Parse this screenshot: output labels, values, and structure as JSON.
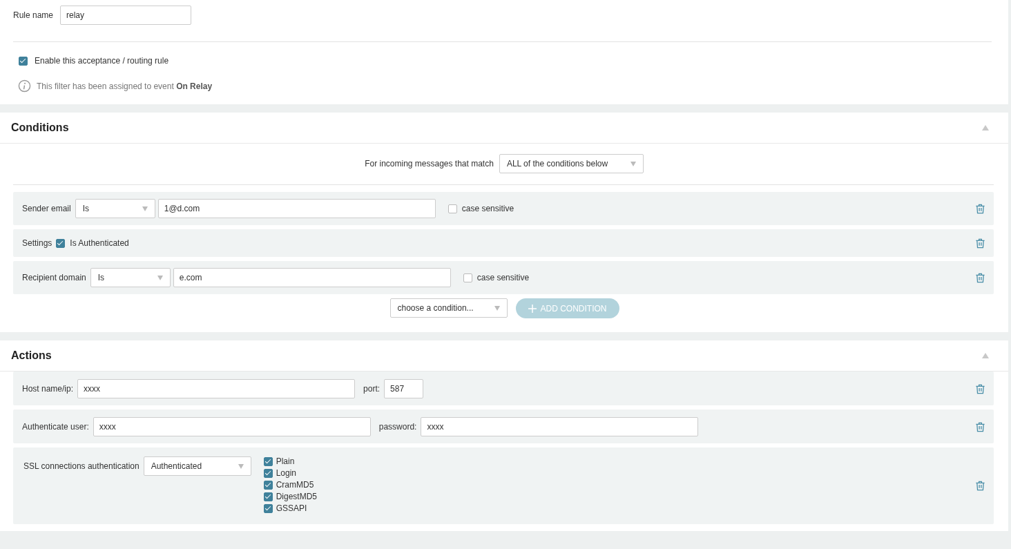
{
  "rule": {
    "label": "Rule name",
    "value": "relay",
    "enable": {
      "label": "Enable this acceptance / routing rule",
      "checked": true
    },
    "info": "This filter has been assigned to event **On Relay**"
  },
  "conditions": {
    "title": "Conditions",
    "match": {
      "label": "For incoming messages that match",
      "value": "ALL of the conditions below"
    },
    "rows": [
      {
        "kind": "text",
        "label": "Sender email",
        "operator": "Is",
        "value": "1@d.com",
        "option": {
          "label": "case sensitive",
          "checked": false
        }
      },
      {
        "kind": "flag",
        "label": "Settings",
        "option": {
          "label": "Is Authenticated",
          "checked": true
        }
      },
      {
        "kind": "text",
        "label": "Recipient domain",
        "operator": "Is",
        "value": "e.com",
        "option": {
          "label": "case sensitive",
          "checked": false
        }
      }
    ],
    "chooser": "choose a condition...",
    "add_button": "ADD CONDITION"
  },
  "actions": {
    "title": "Actions",
    "rows": [
      {
        "kind": "pair",
        "fields": [
          {
            "label": "Host name/ip:",
            "value": "xxxx"
          },
          {
            "label": "port:",
            "value": "587"
          }
        ]
      },
      {
        "kind": "pair",
        "fields": [
          {
            "label": "Authenticate user:",
            "value": "xxxx"
          },
          {
            "label": "password:",
            "value": "xxxx"
          }
        ]
      },
      {
        "kind": "ssl",
        "label": "SSL connections authentication",
        "select": "Authenticated",
        "options": [
          {
            "label": "Plain",
            "checked": true
          },
          {
            "label": "Login",
            "checked": true
          },
          {
            "label": "CramMD5",
            "checked": true
          },
          {
            "label": "DigestMD5",
            "checked": true
          },
          {
            "label": "GSSAPI",
            "checked": true
          }
        ]
      }
    ]
  }
}
